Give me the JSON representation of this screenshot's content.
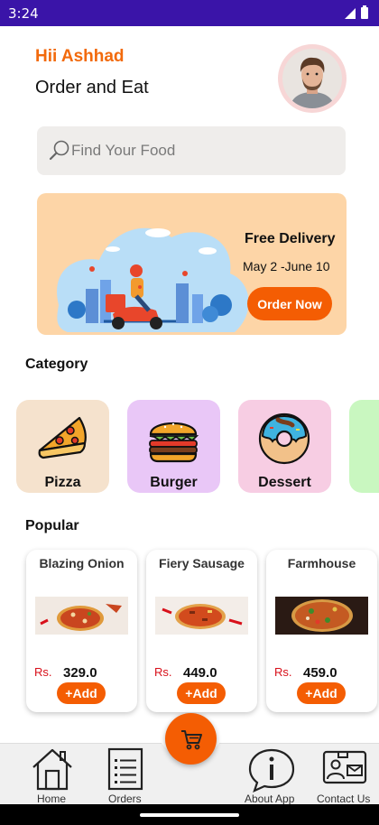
{
  "status_bar": {
    "time": "3:24"
  },
  "header": {
    "greeting": "Hii Ashhad",
    "subtitle": "Order and Eat"
  },
  "search": {
    "placeholder": "Find Your Food"
  },
  "banner": {
    "title": "Free Delivery",
    "date_range": "May 2 -June 10",
    "button_label": "Order Now"
  },
  "categories_section": {
    "title": "Category",
    "items": [
      {
        "label": "Pizza",
        "color": "#f5e2cd",
        "icon": "pizza-icon"
      },
      {
        "label": "Burger",
        "color": "#e9c7f7",
        "icon": "burger-icon"
      },
      {
        "label": "Dessert",
        "color": "#f7cde3",
        "icon": "donut-icon"
      },
      {
        "label": "",
        "color": "#c9f7c0",
        "icon": ""
      }
    ]
  },
  "popular_section": {
    "title": "Popular",
    "items": [
      {
        "name": "Blazing Onion",
        "currency": "Rs.",
        "price": "329.0",
        "add_label": "+Add"
      },
      {
        "name": "Fiery Sausage",
        "currency": "Rs.",
        "price": "449.0",
        "add_label": "+Add"
      },
      {
        "name": "Farmhouse",
        "currency": "Rs.",
        "price": "459.0",
        "add_label": "+Add"
      }
    ]
  },
  "bottom_nav": {
    "items": [
      {
        "label": "Home",
        "icon": "home-icon"
      },
      {
        "label": "Orders",
        "icon": "orders-icon"
      },
      {
        "label": "About App",
        "icon": "info-icon"
      },
      {
        "label": "Contact Us",
        "icon": "contact-card-icon"
      }
    ],
    "fab_icon": "cart-icon"
  },
  "colors": {
    "accent": "#f45d03",
    "greeting": "#f26a0c",
    "status_bar": "#3a14a8",
    "banner_bg": "#fdd5a7",
    "price_currency": "#d8101a"
  }
}
